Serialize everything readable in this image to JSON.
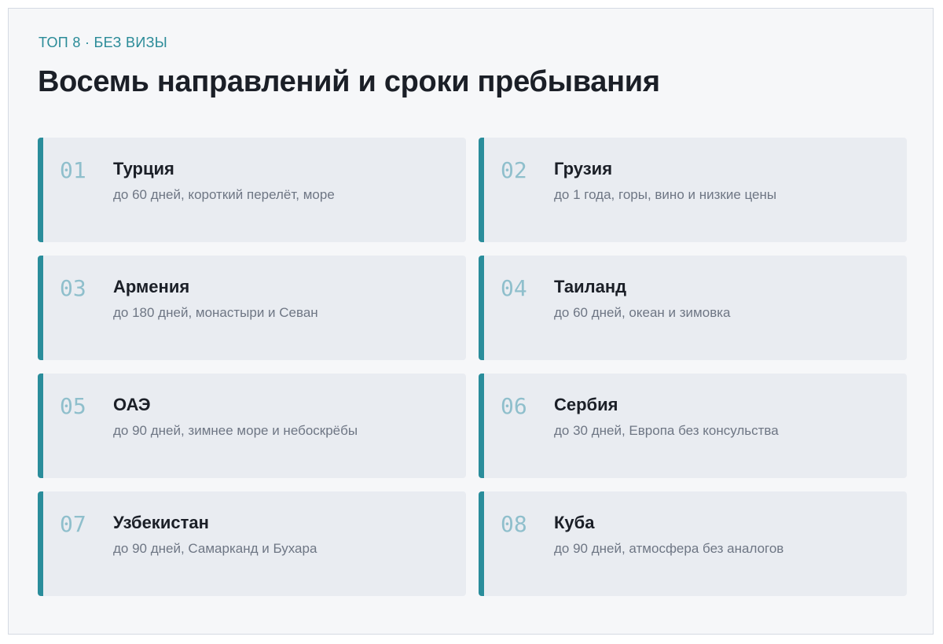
{
  "header": {
    "eyebrow": "ТОП 8 · БЕЗ ВИЗЫ",
    "title": "Восемь направлений и сроки пребывания"
  },
  "accent_color": "#2a8d9b",
  "destinations": [
    {
      "number": "01",
      "name": "Турция",
      "description": "до 60 дней, короткий перелёт, море"
    },
    {
      "number": "02",
      "name": "Грузия",
      "description": "до 1 года, горы, вино и низкие цены"
    },
    {
      "number": "03",
      "name": "Армения",
      "description": "до 180 дней, монастыри и Севан"
    },
    {
      "number": "04",
      "name": "Таиланд",
      "description": "до 60 дней, океан и зимовка"
    },
    {
      "number": "05",
      "name": "ОАЭ",
      "description": "до 90 дней, зимнее море и небоскрёбы"
    },
    {
      "number": "06",
      "name": "Сербия",
      "description": "до 30 дней, Европа без консульства"
    },
    {
      "number": "07",
      "name": "Узбекистан",
      "description": "до 90 дней, Самарканд и Бухара"
    },
    {
      "number": "08",
      "name": "Куба",
      "description": "до 90 дней, атмосфера без аналогов"
    }
  ]
}
